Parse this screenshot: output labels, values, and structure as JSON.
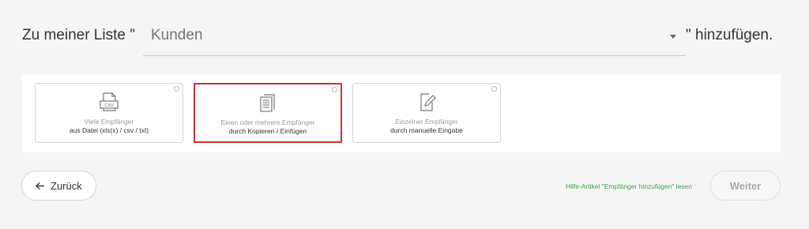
{
  "heading": {
    "prefix": "Zu meiner Liste \"",
    "list_value": "Kunden",
    "suffix": "\" hinzufügen."
  },
  "options": [
    {
      "line1": "Viele Empfänger",
      "line2": "aus Datei (xls(x) / csv / txt)",
      "icon": "csv-file-icon",
      "selected": false
    },
    {
      "line1": "Einen oder mehrere Empfänger",
      "line2": "durch Kopieren / Einfügen",
      "icon": "document-list-icon",
      "selected": true
    },
    {
      "line1": "Einzelner Empfänger",
      "line2": "durch manuelle Eingabe",
      "icon": "edit-document-icon",
      "selected": false
    }
  ],
  "footer": {
    "back_label": "Zurück",
    "help_text": "Hilfe-Artikel \"Empfänger hinzufügen\" lesen",
    "next_label": "Weiter",
    "accent_color": "#d32f2f",
    "help_color": "#43a047"
  }
}
